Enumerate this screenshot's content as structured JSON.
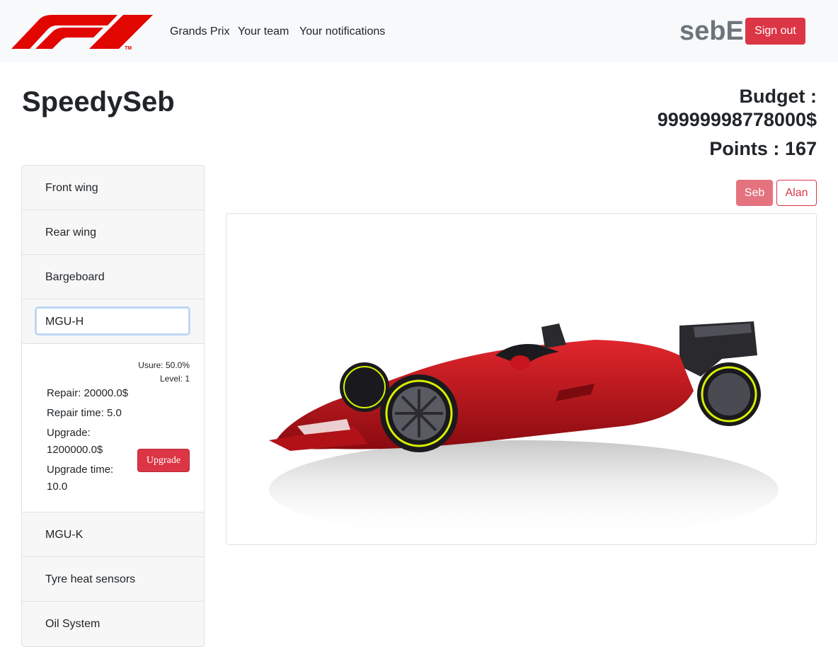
{
  "navbar": {
    "links": [
      "Grands Prix",
      "Your team",
      "Your notifications"
    ],
    "username": "sebE",
    "signout_label": "Sign out",
    "brand_color": "#e10600"
  },
  "team": {
    "name": "SpeedySeb",
    "budget_label": "Budget :",
    "budget_value": "99999998778000$",
    "points_label": "Points :",
    "points_value": "167"
  },
  "drivers": {
    "active": "Seb",
    "other": "Alan"
  },
  "parts": {
    "items": [
      "Front wing",
      "Rear wing",
      "Bargeboard",
      "MGU-H",
      "MGU-K",
      "Tyre heat sensors",
      "Oil System"
    ],
    "open_item": "MGU-H",
    "details": {
      "usure": "Usure: 50.0%",
      "level": "Level: 1",
      "repair": "Repair: 20000.0$",
      "repair_time": "Repair time: 5.0",
      "upgrade_line1": "Upgrade:",
      "upgrade_line2": "1200000.0$",
      "upgrade_time_line1": "Upgrade time:",
      "upgrade_time_line2": "10.0",
      "upgrade_button": "Upgrade"
    }
  },
  "car_image": {
    "icon": "f1-car-image",
    "body_color": "#c8141c",
    "tyre_stripe_color": "#d8f000"
  }
}
